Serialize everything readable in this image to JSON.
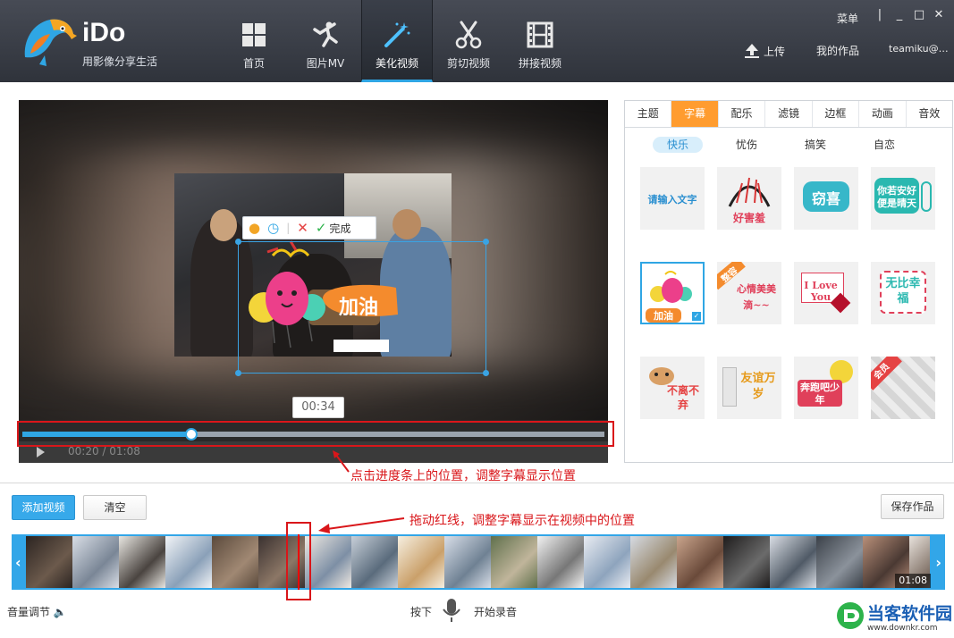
{
  "app": {
    "title": "iDo",
    "subtitle": "用影像分享生活",
    "menu": "菜单",
    "upload": "上传",
    "my_works": "我的作品",
    "user": "teamiku@…"
  },
  "nav": [
    {
      "label": "首页",
      "icon": "home-grid-icon"
    },
    {
      "label": "图片MV",
      "icon": "dancer-icon"
    },
    {
      "label": "美化视频",
      "icon": "magic-wand-icon",
      "active": true
    },
    {
      "label": "剪切视频",
      "icon": "scissors-icon"
    },
    {
      "label": "拼接视频",
      "icon": "film-strip-icon"
    }
  ],
  "player": {
    "tooltip_time": "00:34",
    "current_time": "00:20",
    "total_time": "01:08",
    "progress_fraction": 0.29,
    "sticker_toolbar_done": "完成"
  },
  "sticker_overlay": {
    "text": "加油"
  },
  "panel": {
    "tabs": [
      "主题",
      "字幕",
      "配乐",
      "滤镜",
      "边框",
      "动画",
      "音效"
    ],
    "active_tab": "字幕",
    "categories": [
      "快乐",
      "忧伤",
      "搞笑",
      "自恋"
    ],
    "active_category": "快乐",
    "stickers": [
      {
        "text": "请输入文字"
      },
      {
        "text": "好害羞"
      },
      {
        "text": "窃喜"
      },
      {
        "text": "你若安好便是晴天"
      },
      {
        "text": "加油",
        "selected": true
      },
      {
        "text": "整容",
        "text2": "心情美美滴~~"
      },
      {
        "text": "I Love You"
      },
      {
        "text": "无比幸福"
      },
      {
        "text": "不离不弃"
      },
      {
        "text": "友谊万岁"
      },
      {
        "text": "奔跑吧少年"
      },
      {
        "text": "会员"
      }
    ]
  },
  "annotations": {
    "progress_note": "点击进度条上的位置，调整字幕显示位置",
    "timeline_note": "拖动红线，调整字幕显示在视频中的位置"
  },
  "buttons": {
    "add_video": "添加视频",
    "clear": "清空",
    "save_work": "保存作品"
  },
  "timeline": {
    "duration": "01:08",
    "thumb_count": 20
  },
  "footer": {
    "volume": "音量调节",
    "press": "按下",
    "start_record": "开始录音"
  },
  "watermark": {
    "name": "当客软件园",
    "url": "www.downkr.com"
  },
  "colors": {
    "accent": "#2fa6e4",
    "tab_active": "#ff9c2f",
    "annotation": "#d9161a",
    "header": "#3b3f48"
  }
}
